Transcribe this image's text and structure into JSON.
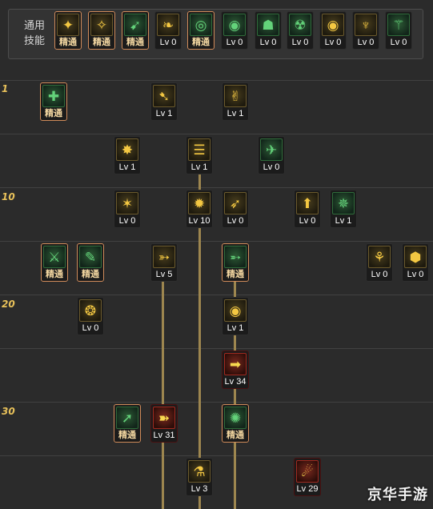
{
  "common": {
    "label_line1": "通用",
    "label_line2": "技能",
    "skills": [
      {
        "name": "common-skill-1",
        "label": "精通",
        "master": true,
        "glyph": "✦",
        "tone": "gold"
      },
      {
        "name": "common-skill-2",
        "label": "精通",
        "master": true,
        "glyph": "✧",
        "tone": "gold"
      },
      {
        "name": "common-skill-3",
        "label": "精通",
        "master": true,
        "glyph": "➹",
        "tone": "green"
      },
      {
        "name": "common-skill-4",
        "label": "Lv 0",
        "master": false,
        "glyph": "❧",
        "tone": "gold"
      },
      {
        "name": "common-skill-5",
        "label": "精通",
        "master": true,
        "glyph": "◎",
        "tone": "green"
      },
      {
        "name": "common-skill-6",
        "label": "Lv 0",
        "master": false,
        "glyph": "◉",
        "tone": "green"
      },
      {
        "name": "common-skill-7",
        "label": "Lv 0",
        "master": false,
        "glyph": "☗",
        "tone": "green"
      },
      {
        "name": "common-skill-8",
        "label": "Lv 0",
        "master": false,
        "glyph": "☢",
        "tone": "green"
      },
      {
        "name": "common-skill-9",
        "label": "Lv 0",
        "master": false,
        "glyph": "◉",
        "tone": "gold"
      },
      {
        "name": "common-skill-10",
        "label": "Lv 0",
        "master": false,
        "glyph": "♆",
        "tone": "gold"
      },
      {
        "name": "common-skill-11",
        "label": "Lv 0",
        "master": false,
        "glyph": "⚚",
        "tone": "green"
      }
    ]
  },
  "level_marks": [
    "1",
    "10",
    "20",
    "30"
  ],
  "tree": [
    {
      "name": "skill-r1-a",
      "label": "精通",
      "master": true,
      "glyph": "✚",
      "tone": "green"
    },
    {
      "name": "skill-r1-b",
      "label": "Lv 1",
      "master": false,
      "glyph": "➷",
      "tone": "gold"
    },
    {
      "name": "skill-r1-c",
      "label": "Lv 1",
      "master": false,
      "glyph": "✌",
      "tone": "gold"
    },
    {
      "name": "skill-r2-a",
      "label": "Lv 1",
      "master": false,
      "glyph": "✸",
      "tone": "gold"
    },
    {
      "name": "skill-r2-b",
      "label": "Lv 1",
      "master": false,
      "glyph": "☰",
      "tone": "gold"
    },
    {
      "name": "skill-r2-c",
      "label": "Lv 0",
      "master": false,
      "glyph": "✈",
      "tone": "green"
    },
    {
      "name": "skill-r3-a",
      "label": "Lv 0",
      "master": false,
      "glyph": "✶",
      "tone": "gold"
    },
    {
      "name": "skill-r3-b",
      "label": "Lv 10",
      "master": false,
      "glyph": "✹",
      "tone": "gold"
    },
    {
      "name": "skill-r3-c",
      "label": "Lv 0",
      "master": false,
      "glyph": "➶",
      "tone": "gold"
    },
    {
      "name": "skill-r3-d",
      "label": "Lv 0",
      "master": false,
      "glyph": "⬆",
      "tone": "gold"
    },
    {
      "name": "skill-r3-e",
      "label": "Lv 1",
      "master": false,
      "glyph": "✵",
      "tone": "green"
    },
    {
      "name": "skill-r4-a",
      "label": "精通",
      "master": true,
      "glyph": "⚔",
      "tone": "green"
    },
    {
      "name": "skill-r4-b",
      "label": "精通",
      "master": true,
      "glyph": "✎",
      "tone": "green"
    },
    {
      "name": "skill-r4-c",
      "label": "Lv 5",
      "master": false,
      "glyph": "➳",
      "tone": "gold"
    },
    {
      "name": "skill-r4-d",
      "label": "精通",
      "master": true,
      "glyph": "➵",
      "tone": "green"
    },
    {
      "name": "skill-r4-e",
      "label": "Lv 0",
      "master": false,
      "glyph": "⚘",
      "tone": "gold"
    },
    {
      "name": "skill-r4-f",
      "label": "Lv 0",
      "master": false,
      "glyph": "⬢",
      "tone": "gold"
    },
    {
      "name": "skill-r5-a",
      "label": "Lv 0",
      "master": false,
      "glyph": "❂",
      "tone": "gold"
    },
    {
      "name": "skill-r5-b",
      "label": "Lv 1",
      "master": false,
      "glyph": "◉",
      "tone": "gold"
    },
    {
      "name": "skill-r6-a",
      "label": "Lv 34",
      "master": false,
      "glyph": "➡",
      "tone": "red"
    },
    {
      "name": "skill-r7-a",
      "label": "精通",
      "master": true,
      "glyph": "➚",
      "tone": "green"
    },
    {
      "name": "skill-r7-b",
      "label": "Lv 31",
      "master": false,
      "glyph": "➽",
      "tone": "red"
    },
    {
      "name": "skill-r7-c",
      "label": "精通",
      "master": true,
      "glyph": "✺",
      "tone": "green"
    },
    {
      "name": "skill-r8-a",
      "label": "Lv 3",
      "master": false,
      "glyph": "⚗",
      "tone": "gold"
    },
    {
      "name": "skill-r8-b",
      "label": "Lv 29",
      "master": false,
      "glyph": "☄",
      "tone": "red"
    }
  ],
  "watermark": "京华手游"
}
